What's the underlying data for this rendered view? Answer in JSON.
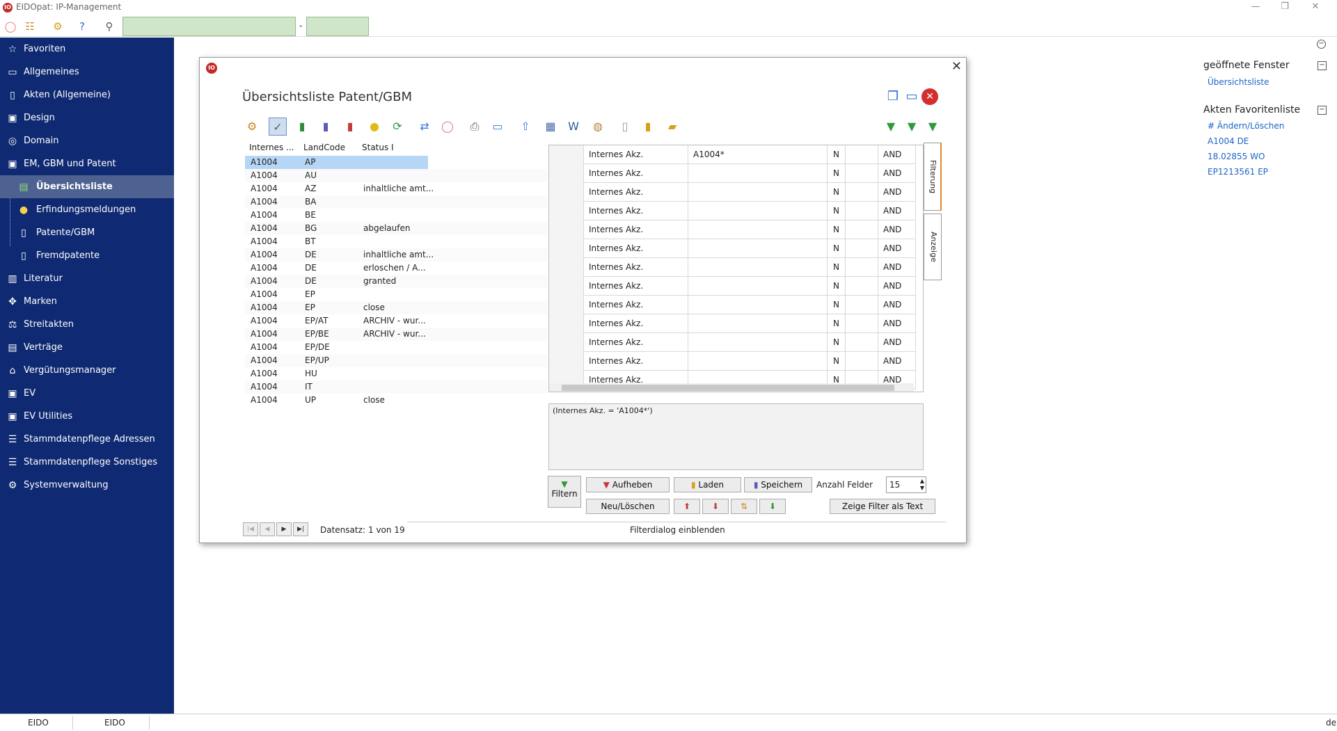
{
  "app": {
    "title": "EIDOpat: IP-Management",
    "logo": "IO"
  },
  "toolbar": {
    "search_value": "",
    "search_to_value": "",
    "range_sep": "-"
  },
  "sidebar": {
    "items": [
      {
        "label": "Favoriten",
        "icon": "star-icon",
        "glyph": "☆"
      },
      {
        "label": "Allgemeines",
        "icon": "briefcase-icon",
        "glyph": "▭"
      },
      {
        "label": "Akten (Allgemeine)",
        "icon": "file-icon",
        "glyph": "▯"
      },
      {
        "label": "Design",
        "icon": "image-icon",
        "glyph": "▣"
      },
      {
        "label": "Domain",
        "icon": "globe-icon",
        "glyph": "◎"
      },
      {
        "label": "EM, GBM und Patent",
        "icon": "document-check-icon",
        "glyph": "▣"
      },
      {
        "label": "Übersichtsliste",
        "icon": "list-icon",
        "glyph": "▤"
      },
      {
        "label": "Erfindungsmeldungen",
        "icon": "lightbulb-icon",
        "glyph": "💡"
      },
      {
        "label": "Patente/GBM",
        "icon": "patent-icon",
        "glyph": "▯"
      },
      {
        "label": "Fremdpatente",
        "icon": "foreign-patent-icon",
        "glyph": "▯"
      },
      {
        "label": "Literatur",
        "icon": "book-icon",
        "glyph": "▥"
      },
      {
        "label": "Marken",
        "icon": "brand-icon",
        "glyph": "✥"
      },
      {
        "label": "Streitakten",
        "icon": "gavel-icon",
        "glyph": "⚖"
      },
      {
        "label": "Verträge",
        "icon": "contract-icon",
        "glyph": "▤"
      },
      {
        "label": "Vergütungsmanager",
        "icon": "bank-icon",
        "glyph": "⌂"
      },
      {
        "label": "EV",
        "icon": "money-icon",
        "glyph": "▣"
      },
      {
        "label": "EV Utilities",
        "icon": "money-tools-icon",
        "glyph": "▣"
      },
      {
        "label": "Stammdatenpflege Adressen",
        "icon": "database-icon",
        "glyph": "☰"
      },
      {
        "label": "Stammdatenpflege Sonstiges",
        "icon": "database-list-icon",
        "glyph": "☰"
      },
      {
        "label": "Systemverwaltung",
        "icon": "gear-icon",
        "glyph": "⚙"
      }
    ]
  },
  "right_panel": {
    "open_windows_title": "geöffnete Fenster",
    "open_windows": [
      "Übersichtsliste"
    ],
    "favorites_title": "Akten Favoritenliste",
    "favorites": [
      "# Ändern/Löschen",
      "A1004 DE",
      "18.02855 WO",
      "EP1213561 EP"
    ]
  },
  "dialog": {
    "title": "Übersichtsliste Patent/GBM",
    "list": {
      "columns": [
        "Internes ...",
        "LandCode",
        "Status I"
      ],
      "rows": [
        [
          "A1004",
          "AP",
          ""
        ],
        [
          "A1004",
          "AU",
          ""
        ],
        [
          "A1004",
          "AZ",
          "inhaltliche amt..."
        ],
        [
          "A1004",
          "BA",
          ""
        ],
        [
          "A1004",
          "BE",
          ""
        ],
        [
          "A1004",
          "BG",
          "abgelaufen"
        ],
        [
          "A1004",
          "BT",
          ""
        ],
        [
          "A1004",
          "DE",
          "inhaltliche amt..."
        ],
        [
          "A1004",
          "DE",
          "erloschen / A..."
        ],
        [
          "A1004",
          "DE",
          "granted"
        ],
        [
          "A1004",
          "EP",
          ""
        ],
        [
          "A1004",
          "EP",
          "close"
        ],
        [
          "A1004",
          "EP/AT",
          "ARCHIV  - wur..."
        ],
        [
          "A1004",
          "EP/BE",
          "ARCHIV  - wur..."
        ],
        [
          "A1004",
          "EP/DE",
          ""
        ],
        [
          "A1004",
          "EP/UP",
          ""
        ],
        [
          "A1004",
          "HU",
          ""
        ],
        [
          "A1004",
          "IT",
          ""
        ],
        [
          "A1004",
          "UP",
          "close"
        ]
      ]
    },
    "filter": {
      "rows": [
        {
          "field": "Internes Akz.",
          "value": "A1004*",
          "n": "N",
          "op": "AND"
        },
        {
          "field": "Internes Akz.",
          "value": "",
          "n": "N",
          "op": "AND"
        },
        {
          "field": "Internes Akz.",
          "value": "",
          "n": "N",
          "op": "AND"
        },
        {
          "field": "Internes Akz.",
          "value": "",
          "n": "N",
          "op": "AND"
        },
        {
          "field": "Internes Akz.",
          "value": "",
          "n": "N",
          "op": "AND"
        },
        {
          "field": "Internes Akz.",
          "value": "",
          "n": "N",
          "op": "AND"
        },
        {
          "field": "Internes Akz.",
          "value": "",
          "n": "N",
          "op": "AND"
        },
        {
          "field": "Internes Akz.",
          "value": "",
          "n": "N",
          "op": "AND"
        },
        {
          "field": "Internes Akz.",
          "value": "",
          "n": "N",
          "op": "AND"
        },
        {
          "field": "Internes Akz.",
          "value": "",
          "n": "N",
          "op": "AND"
        },
        {
          "field": "Internes Akz.",
          "value": "",
          "n": "N",
          "op": "AND"
        },
        {
          "field": "Internes Akz.",
          "value": "",
          "n": "N",
          "op": "AND"
        },
        {
          "field": "Internes Akz.",
          "value": "",
          "n": "N",
          "op": "AND"
        }
      ],
      "text": "(Internes Akz. = 'A1004*')",
      "tabs": [
        "Filterung",
        "Anzeige"
      ],
      "count_label": "Anzahl Felder",
      "count_value": "15"
    },
    "buttons": {
      "filtern": "Filtern",
      "aufheben": "Aufheben",
      "laden": "Laden",
      "speichern": "Speichern",
      "neu_loeschen": "Neu/Löschen",
      "zeige_text": "Zeige Filter als Text"
    },
    "footer": {
      "record_label": "Datensatz:",
      "record_value": "1 von 19",
      "toggle": "Filterdialog einblenden"
    }
  },
  "status": {
    "left1": "EIDO",
    "left2": "EIDO",
    "right": "de"
  }
}
